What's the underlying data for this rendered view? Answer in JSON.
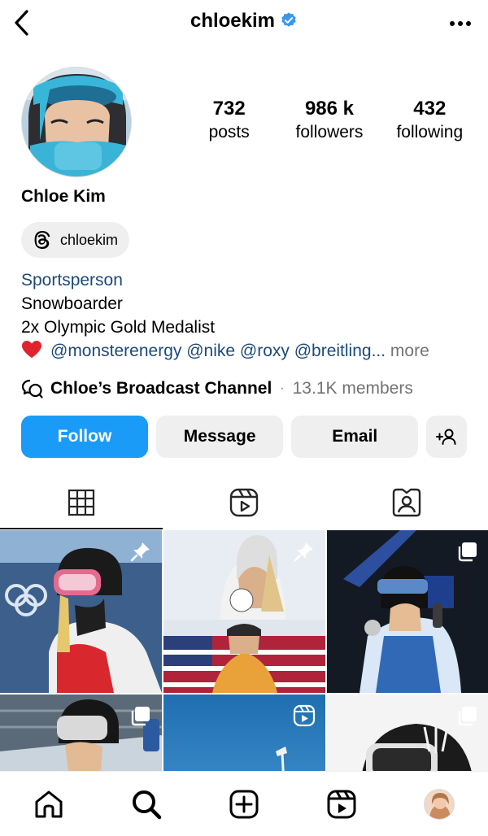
{
  "header": {
    "username": "chloekim",
    "verified": true,
    "icons": {
      "back": "chevron-left-icon",
      "more": "more-horizontal-icon",
      "verified": "verified-badge-icon"
    }
  },
  "profile": {
    "stats": [
      {
        "value": "732",
        "label": "posts"
      },
      {
        "value": "986 k",
        "label": "followers"
      },
      {
        "value": "432",
        "label": "following"
      }
    ],
    "name": "Chloe Kim",
    "threads_handle": "chloekim",
    "bio": {
      "category": "Sportsperson",
      "line1": "Snowboarder",
      "line2": "2x Olympic Gold Medalist",
      "mentions": "@monsterenergy @nike @roxy @breitling...",
      "more": " more"
    },
    "broadcast": {
      "title": "Chloe’s Broadcast Channel",
      "separator": "·",
      "members": "13.1K members"
    }
  },
  "actions": {
    "follow": "Follow",
    "message": "Message",
    "email": "Email"
  },
  "tabs": [
    {
      "id": "posts",
      "icon": "grid-icon",
      "active": true
    },
    {
      "id": "reels",
      "icon": "reels-icon",
      "active": false
    },
    {
      "id": "tagged",
      "icon": "tagged-icon",
      "active": false
    }
  ],
  "grid": {
    "items": [
      {
        "badge": "pin-icon"
      },
      {
        "badge": "pin-icon"
      },
      {
        "badge": "carousel-icon"
      },
      {
        "badge": "carousel-icon"
      },
      {
        "badge": "reel-icon"
      },
      {
        "badge": "carousel-icon"
      }
    ]
  },
  "bottom_nav": [
    "home-icon",
    "search-icon",
    "create-icon",
    "reels-icon",
    "profile-avatar"
  ],
  "colors": {
    "accent": "#1a9bf7",
    "link": "#1c4a78",
    "muted": "#737373",
    "button_bg": "#efefef",
    "verified": "#3897f0"
  }
}
